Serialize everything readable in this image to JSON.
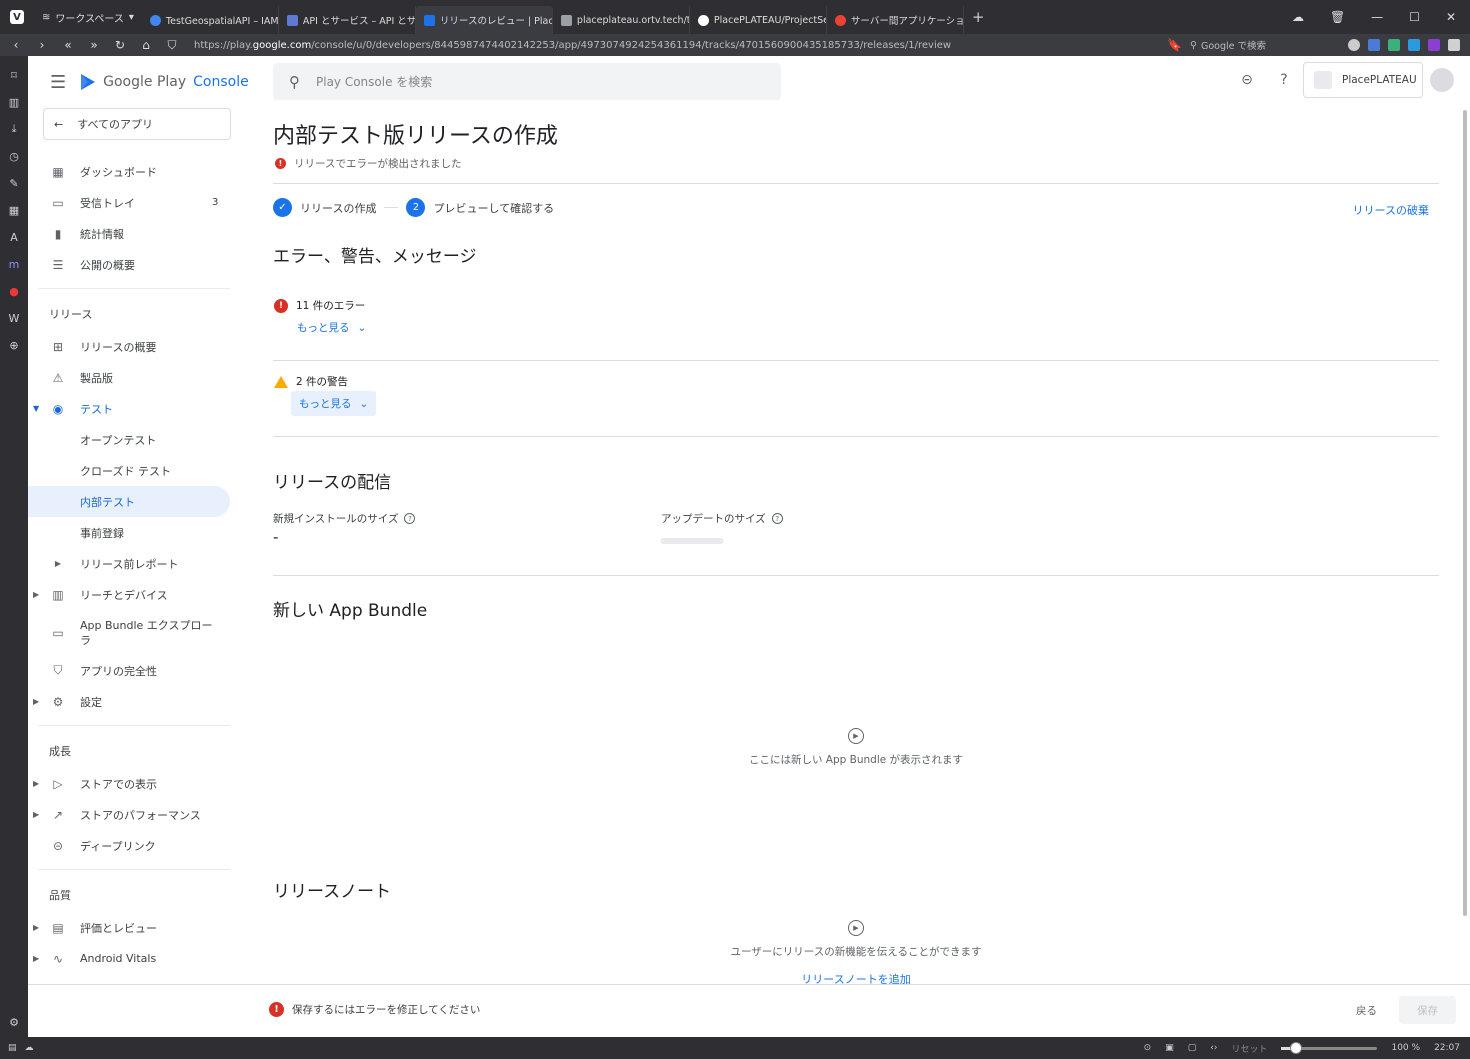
{
  "browser": {
    "workspace_label": "ワークスペース",
    "tabs": [
      {
        "label": "TestGeospatialAPI – IAM と管",
        "color": "#4285f4"
      },
      {
        "label": "API とサービス – API とサービス",
        "color": "#5f7bd1"
      },
      {
        "label": "リリースのレビュー | PlacePLATE",
        "color": "#1a73e8"
      },
      {
        "label": "placeplateau.ortv.tech/toke",
        "color": "#9aa0a6"
      },
      {
        "label": "PlacePLATEAU/ProjectSettin",
        "color": "#ffffff"
      },
      {
        "label": "サーバー間アプリケーションに OA",
        "color": "#ea4335"
      }
    ],
    "url_prefix": "https://play.",
    "url_domain": "google.com",
    "url_path": "/console/u/0/developers/8445987474402142253/app/4973074924254361194/tracks/4701560900435185733/releases/1/review",
    "search_placeholder": "Google で検索",
    "status": {
      "reset": "リセット",
      "zoom": "100 %",
      "zoom_level": 1.0,
      "time": "22:07"
    }
  },
  "console": {
    "brand_google_play": "Google Play",
    "brand_console": "Console",
    "all_apps": "すべてのアプリ",
    "search_placeholder": "Play Console を検索",
    "app_name": "PlacePLATEAU",
    "nav": {
      "dashboard": "ダッシュボード",
      "inbox": "受信トレイ",
      "inbox_count": "3",
      "stats": "統計情報",
      "publishing_overview": "公開の概要",
      "release_section": "リリース",
      "release_overview": "リリースの概要",
      "production": "製品版",
      "testing": "テスト",
      "open_testing": "オープンテスト",
      "closed_testing": "クローズド テスト",
      "internal_testing": "内部テスト",
      "pre_registration": "事前登録",
      "prelaunch_report": "リリース前レポート",
      "reach_devices": "リーチとデバイス",
      "bundle_explorer": "App Bundle エクスプローラ",
      "app_integrity": "アプリの完全性",
      "settings": "設定",
      "growth_section": "成長",
      "store_presence": "ストアでの表示",
      "store_performance": "ストアのパフォーマンス",
      "deep_links": "ディープリンク",
      "quality_section": "品質",
      "ratings_reviews": "評価とレビュー",
      "android_vitals": "Android Vitals"
    },
    "page": {
      "title": "内部テスト版リリースの作成",
      "error_banner": "リリースでエラーが検出されました",
      "step1": "リリースの作成",
      "step2_num": "2",
      "step2": "プレビューして確認する",
      "discard": "リリースの破棄",
      "errors_heading": "エラー、警告、メッセージ",
      "errors_count": "11 件のエラー",
      "show_more": "もっと見る",
      "warnings_count": "2 件の警告",
      "delivery_heading": "リリースの配信",
      "new_install_size": "新規インストールのサイズ",
      "new_install_value": "-",
      "update_size": "アップデートのサイズ",
      "bundle_heading": "新しい App Bundle",
      "bundle_empty": "ここには新しい App Bundle が表示されます",
      "notes_heading": "リリースノート",
      "notes_empty": "ユーザーにリリースの新機能を伝えることができます",
      "add_notes": "リリースノートを追加"
    },
    "footer": {
      "error": "保存するにはエラーを修正してください",
      "back": "戻る",
      "save": "保存"
    }
  }
}
